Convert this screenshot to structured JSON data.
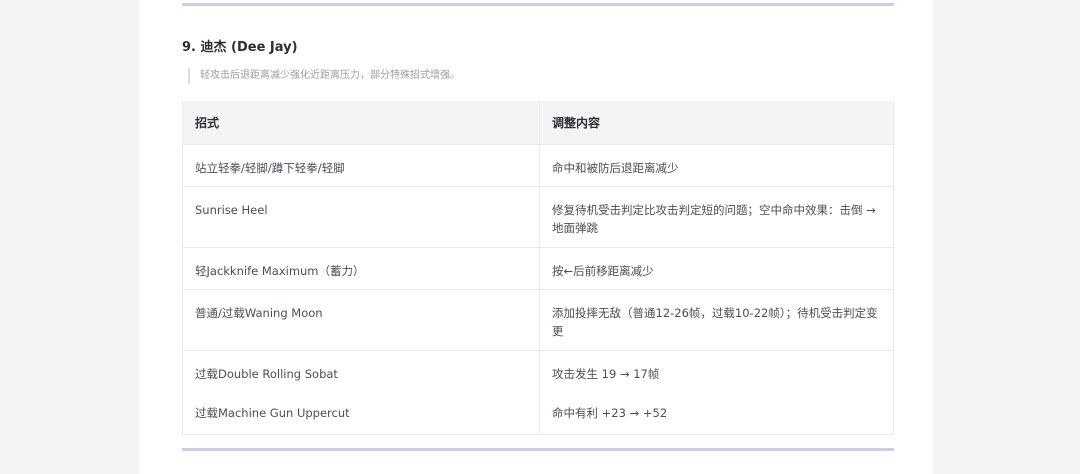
{
  "section": {
    "title": "9. 迪杰 (Dee Jay)",
    "note": "轻攻击后退距离减少强化近距离压力，部分特殊招式增强。"
  },
  "table": {
    "headers": [
      "招式",
      "调整内容"
    ],
    "rows": [
      [
        "站立轻拳/轻脚/蹲下轻拳/轻脚",
        "命中和被防后退距离减少"
      ],
      [
        "Sunrise Heel",
        "修复待机受击判定比攻击判定短的问题；空中命中效果：击倒 → 地面弹跳"
      ],
      [
        "轻Jackknife Maximum（蓄力）",
        "按←后前移距离减少"
      ],
      [
        "普通/过载Waning Moon",
        "添加投摔无敌（普通12-26帧，过载10-22帧）；待机受击判定变更"
      ],
      [
        "过载Double Rolling Sobat",
        "攻击发生 19 → 17帧"
      ],
      [
        "过载Machine Gun Uppercut",
        "命中有利 +23 → +52"
      ]
    ]
  }
}
